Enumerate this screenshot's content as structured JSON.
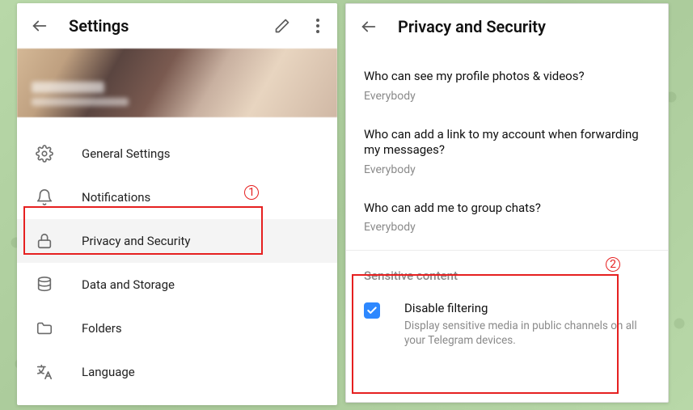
{
  "settings": {
    "title": "Settings",
    "items": [
      {
        "label": "General Settings"
      },
      {
        "label": "Notifications"
      },
      {
        "label": "Privacy and Security"
      },
      {
        "label": "Data and Storage"
      },
      {
        "label": "Folders"
      },
      {
        "label": "Language"
      }
    ]
  },
  "privacy": {
    "title": "Privacy and Security",
    "rows": [
      {
        "question": "Who can see my profile photos & videos?",
        "value": "Everybody"
      },
      {
        "question": "Who can add a link to my account when forwarding my messages?",
        "value": "Everybody"
      },
      {
        "question": "Who can add me to group chats?",
        "value": "Everybody"
      }
    ],
    "sensitive": {
      "section_title": "Sensitive content",
      "checkbox_label": "Disable filtering",
      "checkbox_desc": "Display sensitive media in public channels on all your Telegram devices.",
      "checked": true
    }
  },
  "annotations": {
    "n1": "1",
    "n2": "2"
  }
}
